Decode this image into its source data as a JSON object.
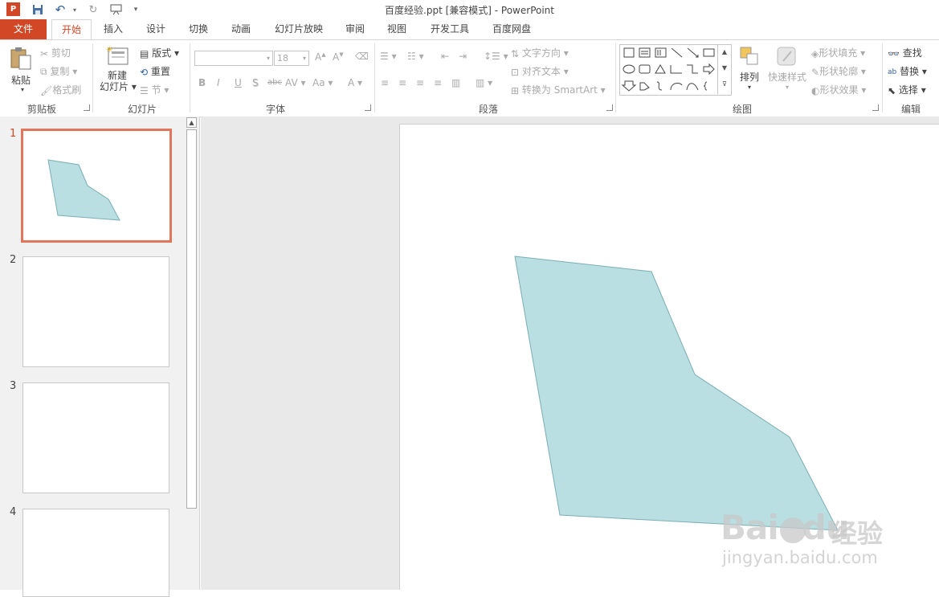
{
  "window": {
    "title": "百度经验.ppt [兼容模式] - PowerPoint",
    "app_icon": "powerpoint-icon"
  },
  "quick_access": [
    {
      "name": "save-icon",
      "glyph": "💾"
    },
    {
      "name": "undo-icon",
      "glyph": "↶"
    },
    {
      "name": "redo-icon",
      "glyph": "↻"
    },
    {
      "name": "present-icon",
      "glyph": "⊞"
    }
  ],
  "tabs": [
    {
      "id": "file",
      "label": "文件"
    },
    {
      "id": "home",
      "label": "开始"
    },
    {
      "id": "insert",
      "label": "插入"
    },
    {
      "id": "design",
      "label": "设计"
    },
    {
      "id": "transitions",
      "label": "切换"
    },
    {
      "id": "animations",
      "label": "动画"
    },
    {
      "id": "slideshow",
      "label": "幻灯片放映"
    },
    {
      "id": "review",
      "label": "审阅"
    },
    {
      "id": "view",
      "label": "视图"
    },
    {
      "id": "developer",
      "label": "开发工具"
    },
    {
      "id": "baidu",
      "label": "百度网盘"
    }
  ],
  "ribbon": {
    "clipboard": {
      "label": "剪贴板",
      "paste": "粘贴",
      "cut": "剪切",
      "copy": "复制",
      "format_painter": "格式刷"
    },
    "slides": {
      "label": "幻灯片",
      "new_slide_1": "新建",
      "new_slide_2": "幻灯片",
      "layout": "版式",
      "reset": "重置",
      "section": "节"
    },
    "font": {
      "label": "字体",
      "font_name": "",
      "font_size": "18",
      "bold": "B",
      "italic": "I",
      "underline": "U",
      "shadow": "S",
      "strike": "abc",
      "spacing": "AV",
      "case": "Aa",
      "color": "A"
    },
    "paragraph": {
      "label": "段落",
      "text_direction": "文字方向",
      "align_text": "对齐文本",
      "smartart": "转换为 SmartArt"
    },
    "drawing": {
      "label": "绘图",
      "arrange": "排列",
      "quick_styles": "快速样式",
      "shape_fill": "形状填充",
      "shape_outline": "形状轮廓",
      "shape_effects": "形状效果"
    },
    "editing": {
      "label": "编辑",
      "find": "查找",
      "replace": "替换",
      "select": "选择"
    }
  },
  "slides": [
    {
      "number": "1",
      "selected": true,
      "has_shape": true
    },
    {
      "number": "2",
      "selected": false
    },
    {
      "number": "3",
      "selected": false
    },
    {
      "number": "4",
      "selected": false
    }
  ],
  "shape": {
    "fill": "#b9dfe2",
    "stroke": "#7aaeb4"
  },
  "colors": {
    "accent": "#d24726",
    "selection": "#e0765a"
  },
  "watermark": {
    "brand": "Bai",
    "brand2": "du",
    "cn": "经验",
    "url": "jingyan.baidu.com"
  }
}
